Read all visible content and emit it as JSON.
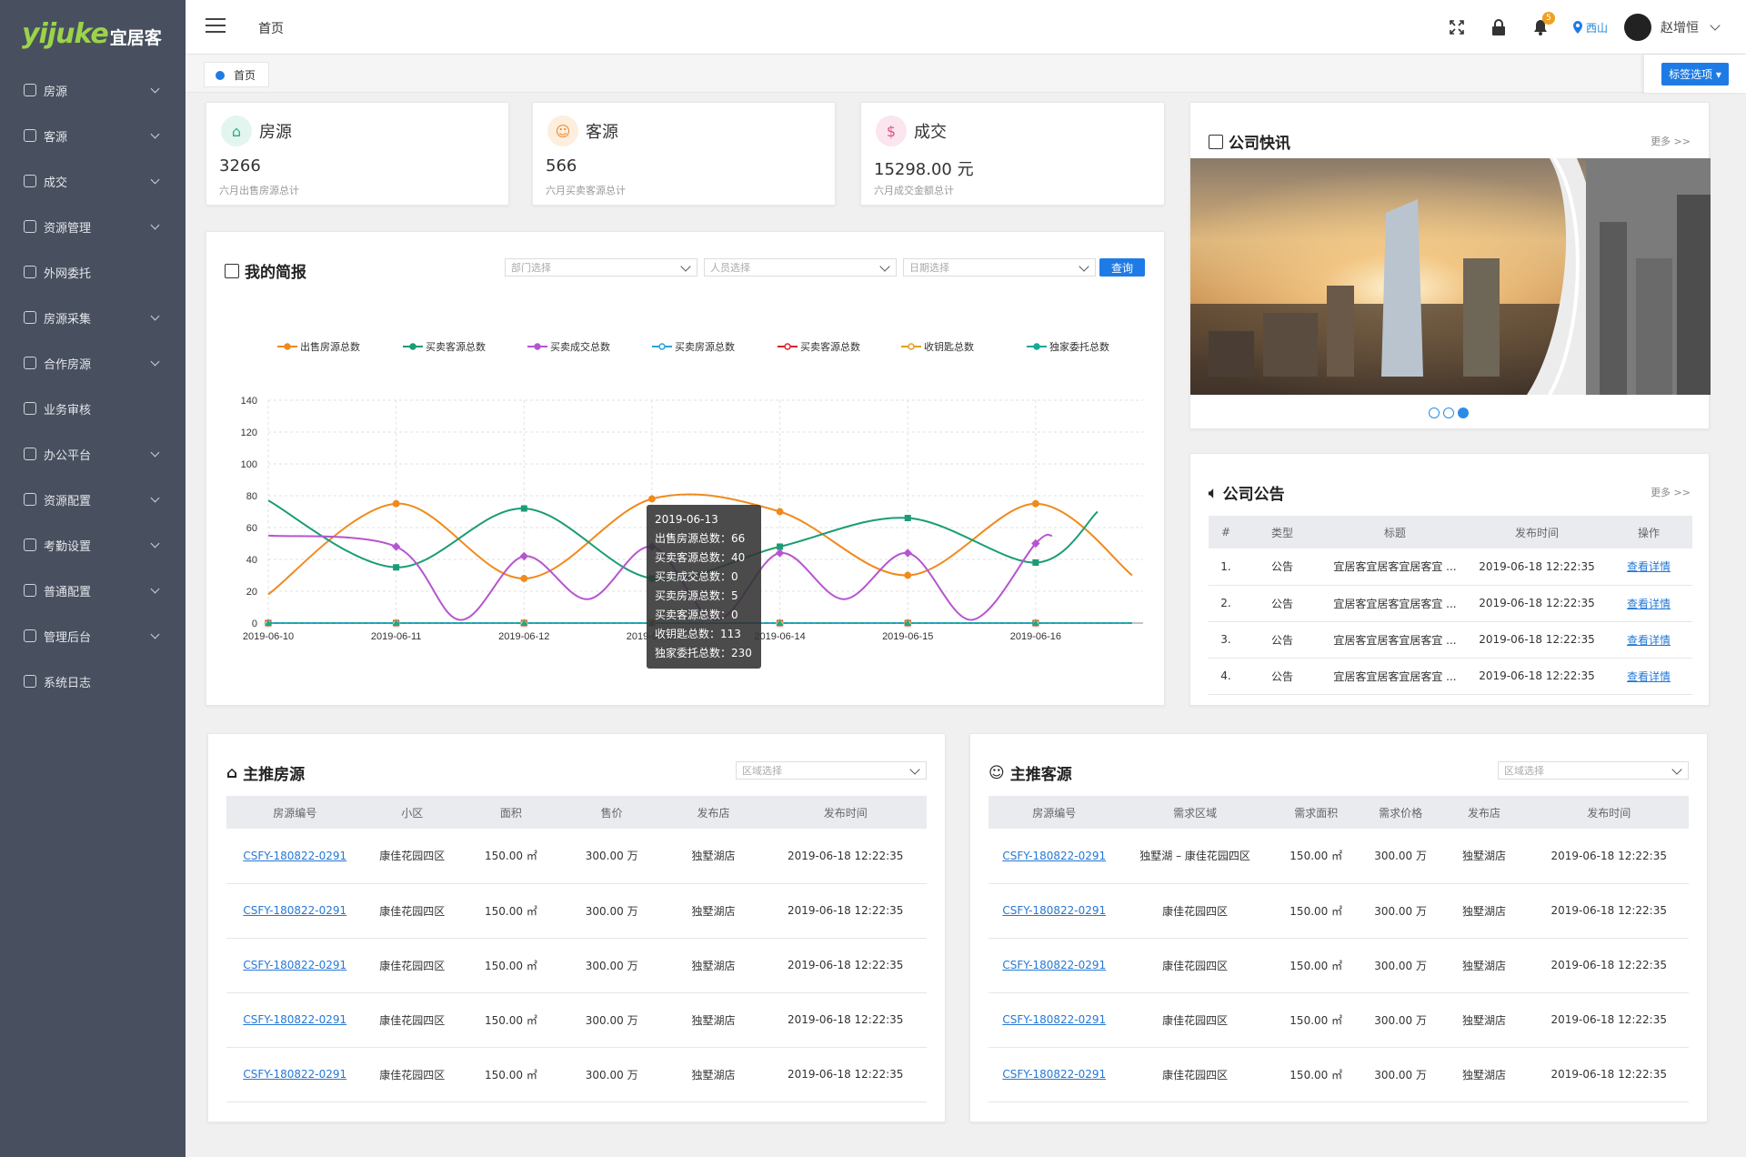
{
  "sidebar": {
    "logo_en": "yijuke",
    "logo_cn": "宜居客",
    "items": [
      {
        "label": "房源",
        "chevron": true
      },
      {
        "label": "客源",
        "chevron": true
      },
      {
        "label": "成交",
        "chevron": true
      },
      {
        "label": "资源管理",
        "chevron": true
      },
      {
        "label": "外网委托",
        "chevron": false
      },
      {
        "label": "房源采集",
        "chevron": true
      },
      {
        "label": "合作房源",
        "chevron": true
      },
      {
        "label": "业务审核",
        "chevron": false
      },
      {
        "label": "办公平台",
        "chevron": true
      },
      {
        "label": "资源配置",
        "chevron": true
      },
      {
        "label": "考勤设置",
        "chevron": true
      },
      {
        "label": "普通配置",
        "chevron": true
      },
      {
        "label": "管理后台",
        "chevron": true
      },
      {
        "label": "系统日志",
        "chevron": false
      }
    ]
  },
  "header": {
    "page_title": "首页",
    "notification_count": "5",
    "location": "西山",
    "username": "赵增恒"
  },
  "tabs": {
    "home_tab": "首页",
    "tag_options": "标签选项"
  },
  "stats": [
    {
      "title": "房源",
      "value": "3266",
      "sub": "六月出售房源总计"
    },
    {
      "title": "客源",
      "value": "566",
      "sub": "六月买卖客源总计"
    },
    {
      "title": "成交",
      "value": "15298.00 元",
      "sub": "六月成交金额总计"
    }
  ],
  "report": {
    "title": "我的简报",
    "dept_placeholder": "部门选择",
    "staff_placeholder": "人员选择",
    "date_placeholder": "日期选择",
    "query_button": "查询"
  },
  "chart_data": {
    "type": "line",
    "categories": [
      "2019-06-10",
      "2019-06-11",
      "2019-06-12",
      "2019-06-13",
      "2019-06-14",
      "2019-06-15",
      "2019-06-16"
    ],
    "ylim": [
      0,
      140
    ],
    "yticks": [
      0,
      20,
      40,
      60,
      80,
      100,
      120,
      140
    ],
    "series": [
      {
        "name": "出售房源总数",
        "color": "#f08a1c",
        "marker": "circle",
        "values": [
          null,
          75,
          28,
          78,
          70,
          30,
          75
        ]
      },
      {
        "name": "买卖客源总数",
        "color": "#1a9c76",
        "marker": "square",
        "values": [
          null,
          35,
          72,
          28,
          48,
          66,
          38
        ]
      },
      {
        "name": "买卖成交总数",
        "color": "#b655d0",
        "marker": "diamond",
        "values": [
          null,
          48,
          42,
          48,
          44,
          44,
          50
        ]
      },
      {
        "name": "买卖房源总数",
        "color": "#2aa4d8",
        "marker": "hollow-circle",
        "values": [
          0,
          0,
          0,
          0,
          0,
          0,
          0
        ]
      },
      {
        "name": "买卖客源总数",
        "color": "#d9232e",
        "marker": "hollow-square",
        "values": [
          0,
          0,
          0,
          0,
          0,
          0,
          0
        ]
      },
      {
        "name": "收钥匙总数",
        "color": "#e0a020",
        "marker": "hollow-diamond",
        "values": [
          0,
          0,
          0,
          0,
          0,
          0,
          0
        ]
      },
      {
        "name": "独家委托总数",
        "color": "#1aa89a",
        "marker": "triangle",
        "values": [
          0,
          0,
          0,
          0,
          0,
          0,
          0
        ]
      }
    ],
    "tooltip": {
      "date": "2019-06-13",
      "lines": [
        "出售房源总数：66",
        "买卖客源总数：40",
        "买卖成交总数：0",
        "买卖房源总数：5",
        "买卖客源总数：0",
        "收钥匙总数：113",
        "独家委托总数：230"
      ]
    }
  },
  "news": {
    "title": "公司快讯",
    "more": "更多 >>"
  },
  "notice": {
    "title": "公司公告",
    "more": "更多 >>",
    "headers": [
      "#",
      "类型",
      "标题",
      "发布时间",
      "操作"
    ],
    "rows": [
      {
        "no": "1.",
        "type": "公告",
        "title": "宜居客宜居客宜居客宜 ...",
        "time": "2019-06-18  12:22:35",
        "action": "查看详情"
      },
      {
        "no": "2.",
        "type": "公告",
        "title": "宜居客宜居客宜居客宜 ...",
        "time": "2019-06-18  12:22:35",
        "action": "查看详情"
      },
      {
        "no": "3.",
        "type": "公告",
        "title": "宜居客宜居客宜居客宜 ...",
        "time": "2019-06-18  12:22:35",
        "action": "查看详情"
      },
      {
        "no": "4.",
        "type": "公告",
        "title": "宜居客宜居客宜居客宜 ...",
        "time": "2019-06-18  12:22:35",
        "action": "查看详情"
      }
    ]
  },
  "featured_houses": {
    "title": "主推房源",
    "area_placeholder": "区域选择",
    "headers": [
      "房源编号",
      "小区",
      "面积",
      "售价",
      "发布店",
      "发布时间"
    ],
    "rows": [
      [
        "CSFY-180822-0291",
        "康佳花园四区",
        "150.00 ㎡",
        "300.00 万",
        "独墅湖店",
        "2019-06-18  12:22:35"
      ],
      [
        "CSFY-180822-0291",
        "康佳花园四区",
        "150.00 ㎡",
        "300.00 万",
        "独墅湖店",
        "2019-06-18  12:22:35"
      ],
      [
        "CSFY-180822-0291",
        "康佳花园四区",
        "150.00 ㎡",
        "300.00 万",
        "独墅湖店",
        "2019-06-18  12:22:35"
      ],
      [
        "CSFY-180822-0291",
        "康佳花园四区",
        "150.00 ㎡",
        "300.00 万",
        "独墅湖店",
        "2019-06-18  12:22:35"
      ],
      [
        "CSFY-180822-0291",
        "康佳花园四区",
        "150.00 ㎡",
        "300.00 万",
        "独墅湖店",
        "2019-06-18  12:22:35"
      ]
    ]
  },
  "featured_clients": {
    "title": "主推客源",
    "area_placeholder": "区域选择",
    "headers": [
      "房源编号",
      "需求区域",
      "需求面积",
      "需求价格",
      "发布店",
      "发布时间"
    ],
    "rows": [
      [
        "CSFY-180822-0291",
        "独墅湖 – 康佳花园四区",
        "150.00 ㎡",
        "300.00 万",
        "独墅湖店",
        "2019-06-18  12:22:35"
      ],
      [
        "CSFY-180822-0291",
        "康佳花园四区",
        "150.00 ㎡",
        "300.00 万",
        "独墅湖店",
        "2019-06-18  12:22:35"
      ],
      [
        "CSFY-180822-0291",
        "康佳花园四区",
        "150.00 ㎡",
        "300.00 万",
        "独墅湖店",
        "2019-06-18  12:22:35"
      ],
      [
        "CSFY-180822-0291",
        "康佳花园四区",
        "150.00 ㎡",
        "300.00 万",
        "独墅湖店",
        "2019-06-18  12:22:35"
      ],
      [
        "CSFY-180822-0291",
        "康佳花园四区",
        "150.00 ㎡",
        "300.00 万",
        "独墅湖店",
        "2019-06-18  12:22:35"
      ]
    ]
  }
}
